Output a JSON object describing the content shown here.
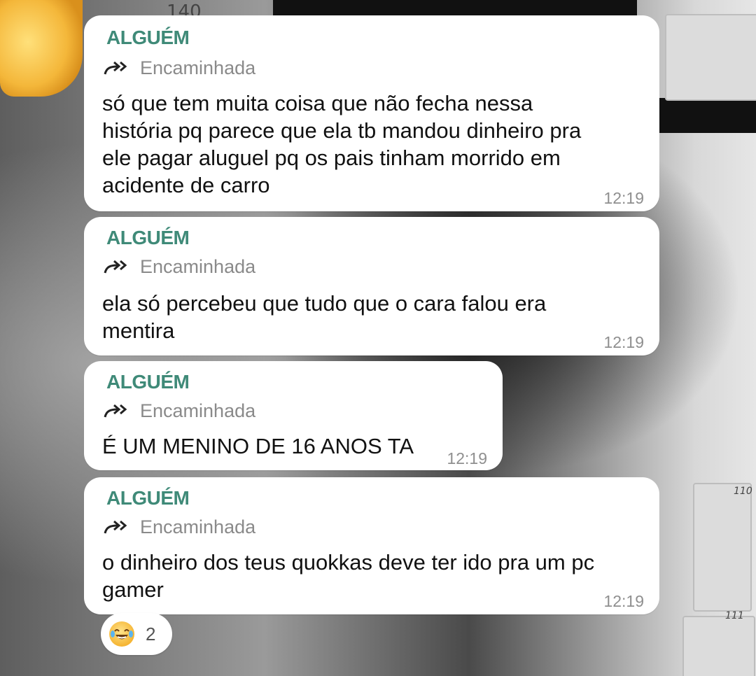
{
  "wallpaper": {
    "locker_numbers": [
      "140",
      "110",
      "111"
    ]
  },
  "messages": [
    {
      "sender": "ALGUÉM",
      "forwarded_label": "Encaminhada",
      "text": "só que tem muita coisa que não fecha nessa\nhistória pq parece que ela tb mandou dinheiro pra\nele pagar aluguel pq os pais tinham morrido em\nacidente de carro",
      "time": "12:19"
    },
    {
      "sender": "ALGUÉM",
      "forwarded_label": "Encaminhada",
      "text": "ela só percebeu que tudo que o cara falou era\nmentira",
      "time": "12:19"
    },
    {
      "sender": "ALGUÉM",
      "forwarded_label": "Encaminhada",
      "text": "É UM MENINO DE 16 ANOS TA",
      "time": "12:19"
    },
    {
      "sender": "ALGUÉM",
      "forwarded_label": "Encaminhada",
      "text": "o dinheiro dos teus quokkas deve ter ido pra um pc\ngamer",
      "time": "12:19"
    }
  ],
  "reaction": {
    "emoji_icon": "face-with-tears-of-joy-icon",
    "count": "2"
  },
  "colors": {
    "sender": "#3f8a78",
    "bubble": "#ffffff",
    "meta": "#8f8f8f"
  }
}
